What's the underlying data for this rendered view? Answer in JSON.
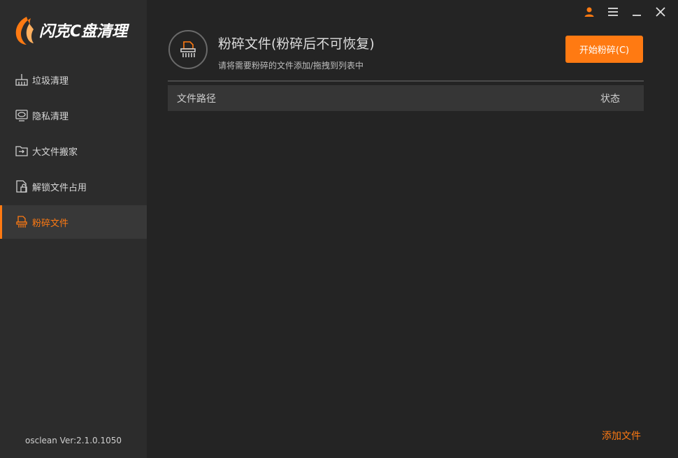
{
  "app": {
    "name": "闪克C盘清理",
    "version": "osclean Ver:2.1.0.1050"
  },
  "colors": {
    "accent": "#ff7a12",
    "sidebar_bg": "#2c2c2c",
    "main_bg": "#242424"
  },
  "window_controls": [
    {
      "icon": "user-icon"
    },
    {
      "icon": "menu-icon"
    },
    {
      "icon": "minimize-icon"
    },
    {
      "icon": "close-icon"
    }
  ],
  "sidebar": {
    "items": [
      {
        "label": "垃圾清理",
        "icon": "broom-icon",
        "active": false
      },
      {
        "label": "隐私清理",
        "icon": "privacy-icon",
        "active": false
      },
      {
        "label": "大文件搬家",
        "icon": "folder-move-icon",
        "active": false
      },
      {
        "label": "解锁文件占用",
        "icon": "unlock-file-icon",
        "active": false
      },
      {
        "label": "粉碎文件",
        "icon": "shredder-icon",
        "active": true
      }
    ]
  },
  "main": {
    "title": "粉碎文件(粉碎后不可恢复)",
    "subtitle": "请将需要粉碎的文件添加/拖拽到列表中",
    "start_button": "开始粉碎(C)",
    "table": {
      "columns": [
        "文件路径",
        "状态"
      ],
      "rows": []
    },
    "add_file": "添加文件"
  }
}
